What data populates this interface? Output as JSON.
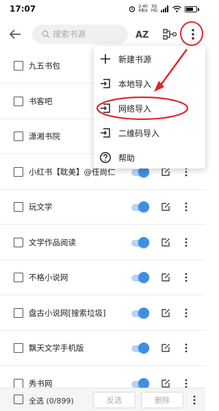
{
  "status_bar": {
    "time": "17:07",
    "speed_value": "2.40",
    "speed_unit": "KB/s",
    "network": "5G",
    "network_sub": "HD",
    "battery_level": 0.7
  },
  "toolbar": {
    "search_placeholder": "搜索书源",
    "sort_label": "AZ"
  },
  "sources": [
    {
      "name": "九五书包",
      "enabled": true
    },
    {
      "name": "书客吧",
      "enabled": true
    },
    {
      "name": "潇湘书院",
      "enabled": true
    },
    {
      "name": "小红书【耽美】@任尚仁",
      "enabled": true
    },
    {
      "name": "玩文学",
      "enabled": true
    },
    {
      "name": "文学作品阅读",
      "enabled": true
    },
    {
      "name": "不格小说网",
      "enabled": true
    },
    {
      "name": "盘古小说网[搜索垃圾]",
      "enabled": true
    },
    {
      "name": "飘天文学手机版",
      "enabled": true
    },
    {
      "name": "秀书网",
      "enabled": true
    }
  ],
  "menu": {
    "items": [
      {
        "label": "新建书源",
        "icon": "plus-icon"
      },
      {
        "label": "本地导入",
        "icon": "import-icon"
      },
      {
        "label": "网络导入",
        "icon": "import-icon"
      },
      {
        "label": "二维码导入",
        "icon": "import-icon"
      },
      {
        "label": "帮助",
        "icon": "help-icon"
      }
    ]
  },
  "bottom_bar": {
    "select_all_label": "全选 (0/899)",
    "invert_label": "反选",
    "delete_label": "删除"
  },
  "colors": {
    "accent": "#3d8fe6",
    "annotation": "#e0262b"
  }
}
